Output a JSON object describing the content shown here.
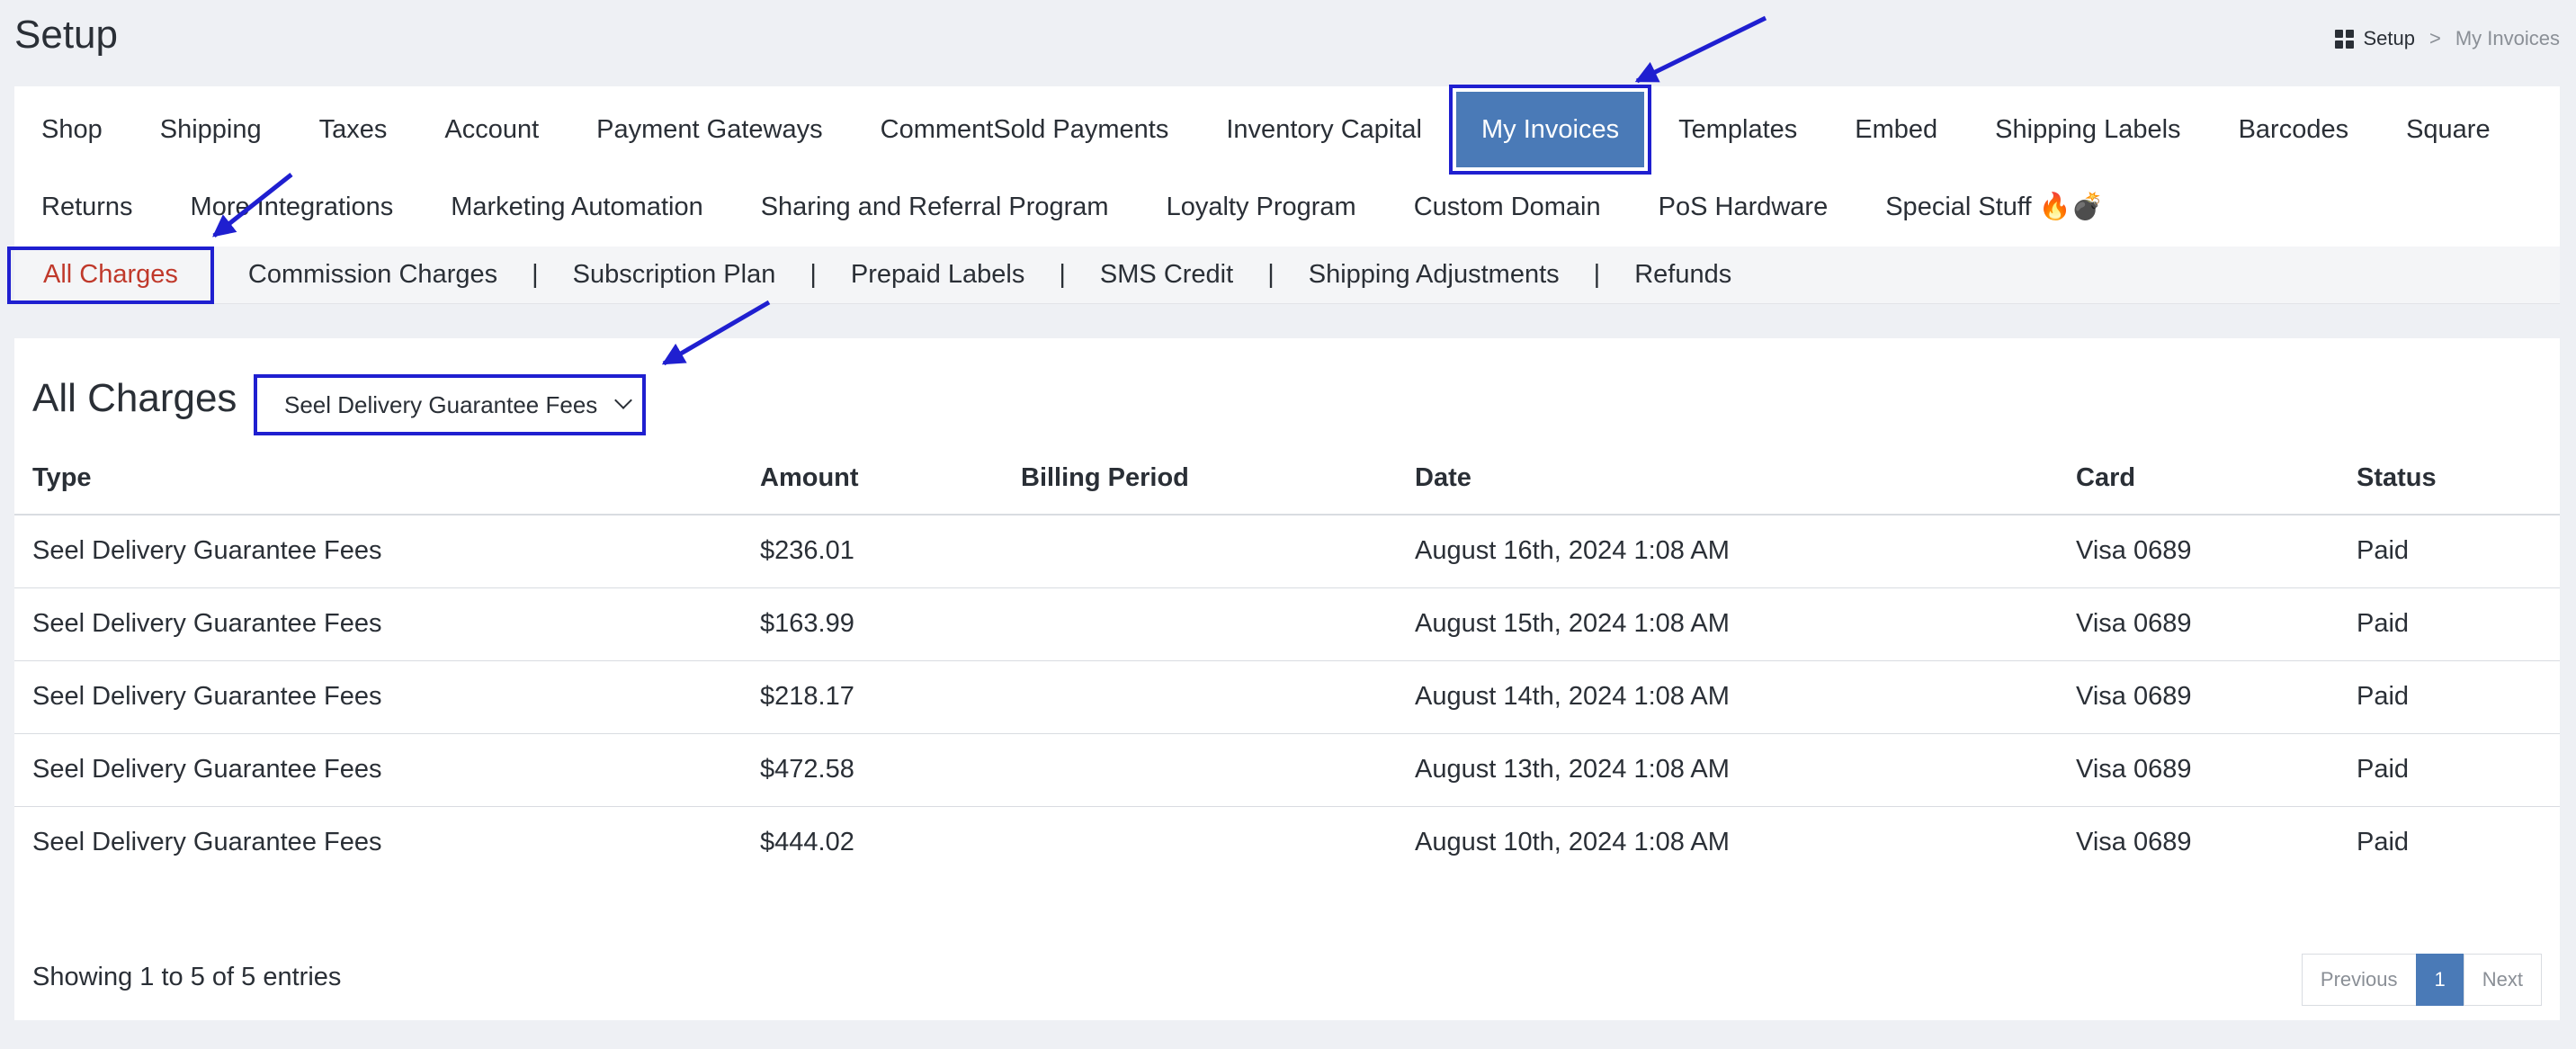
{
  "header": {
    "title": "Setup",
    "breadcrumb": {
      "home": "Setup",
      "separator": ">",
      "current": "My Invoices"
    }
  },
  "tabs_row1": [
    "Shop",
    "Shipping",
    "Taxes",
    "Account",
    "Payment Gateways",
    "CommentSold Payments",
    "Inventory Capital",
    "My Invoices",
    "Templates",
    "Embed",
    "Shipping Labels",
    "Barcodes",
    "Square"
  ],
  "tabs_row2": [
    "Returns",
    "More Integrations",
    "Marketing Automation",
    "Sharing and Referral Program",
    "Loyalty Program",
    "Custom Domain",
    "PoS Hardware",
    "Special Stuff 🔥💣"
  ],
  "active_tab": "My Invoices",
  "subnav": [
    "All Charges",
    "Commission Charges",
    "Subscription Plan",
    "Prepaid Labels",
    "SMS Credit",
    "Shipping Adjustments",
    "Refunds"
  ],
  "subnav_separator": "|",
  "main": {
    "title": "All Charges",
    "filter_value": "Seel Delivery Guarantee Fees",
    "columns": [
      "Type",
      "Amount",
      "Billing Period",
      "Date",
      "Card",
      "Status"
    ],
    "rows": [
      [
        "Seel Delivery Guarantee Fees",
        "$236.01",
        "",
        "August 16th, 2024 1:08 AM",
        "Visa 0689",
        "Paid"
      ],
      [
        "Seel Delivery Guarantee Fees",
        "$163.99",
        "",
        "August 15th, 2024 1:08 AM",
        "Visa 0689",
        "Paid"
      ],
      [
        "Seel Delivery Guarantee Fees",
        "$218.17",
        "",
        "August 14th, 2024 1:08 AM",
        "Visa 0689",
        "Paid"
      ],
      [
        "Seel Delivery Guarantee Fees",
        "$472.58",
        "",
        "August 13th, 2024 1:08 AM",
        "Visa 0689",
        "Paid"
      ],
      [
        "Seel Delivery Guarantee Fees",
        "$444.02",
        "",
        "August 10th, 2024 1:08 AM",
        "Visa 0689",
        "Paid"
      ]
    ],
    "entries_text": "Showing 1 to 5 of 5 entries",
    "pagination": {
      "previous": "Previous",
      "page": "1",
      "next": "Next"
    }
  },
  "colors": {
    "accent": "#4a7ab7",
    "annotation": "#1f1fd0",
    "active_subtab": "#c0392b"
  }
}
